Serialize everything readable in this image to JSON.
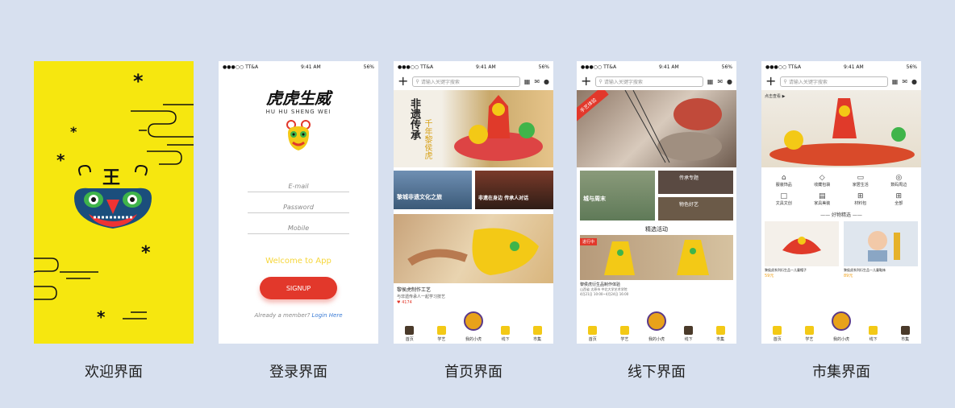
{
  "captions": {
    "welcome": "欢迎界面",
    "login": "登录界面",
    "home": "首页界面",
    "offline": "线下界面",
    "market": "市集界面"
  },
  "status": {
    "carrier": "●●●○○ TT&A",
    "time": "9:41 AM",
    "battery": "56%"
  },
  "login": {
    "brand": "虎虎生威",
    "brand_pinyin": "HU HU SHENG WEI",
    "email_placeholder": "E-mail",
    "password_placeholder": "Password",
    "mobile_placeholder": "Mobile",
    "welcome": "Welcome to App",
    "signup": "SIGNUP",
    "already": "Already a member?",
    "login_link": "Login Here"
  },
  "search_placeholder": "请输入关键字搜索",
  "home": {
    "banner_title": "非遗传承",
    "banner_sub": "千年黎侯虎",
    "card1": "黎城非遗文化之旅",
    "card2": "非遗在身边 传承人对话",
    "feature_title": "黎侯虎制作工艺",
    "feature_sub": "与非遗传承人一起学习技艺",
    "feature_meta": "4174"
  },
  "offline": {
    "badge": "手艺体验",
    "card1": "城与周末",
    "card2": "传承专题",
    "card3": "物色好艺",
    "section": "精选活动",
    "tag": "进行中",
    "event_title": "黎侯虎衍生品制作体验",
    "event_loc": "山西省 太原市 中北大学艺术学院",
    "event_time": "4月21日 10:00~4月24日 16:00"
  },
  "market": {
    "banner_label": "点击查看 ▶",
    "categories": [
      "服装饰品",
      "收藏包袋",
      "家居生活",
      "数码周边",
      "文具文创",
      "家具美装",
      "材料包",
      "全部"
    ],
    "section": "好物精选",
    "item1": "黎侯虎系列衍生品—儿童帽子",
    "item1_price": "59元",
    "item2": "黎侯虎系列衍生品—儿童鞋袜",
    "item2_price": "89元"
  },
  "tabs": [
    "首页",
    "学艺",
    "我的小虎",
    "线下",
    "市集"
  ],
  "colors": {
    "background": "#d7e0ef",
    "welcome_yellow": "#f6e70f",
    "signup_red": "#e2382b",
    "accent_yellow": "#f3c916"
  }
}
